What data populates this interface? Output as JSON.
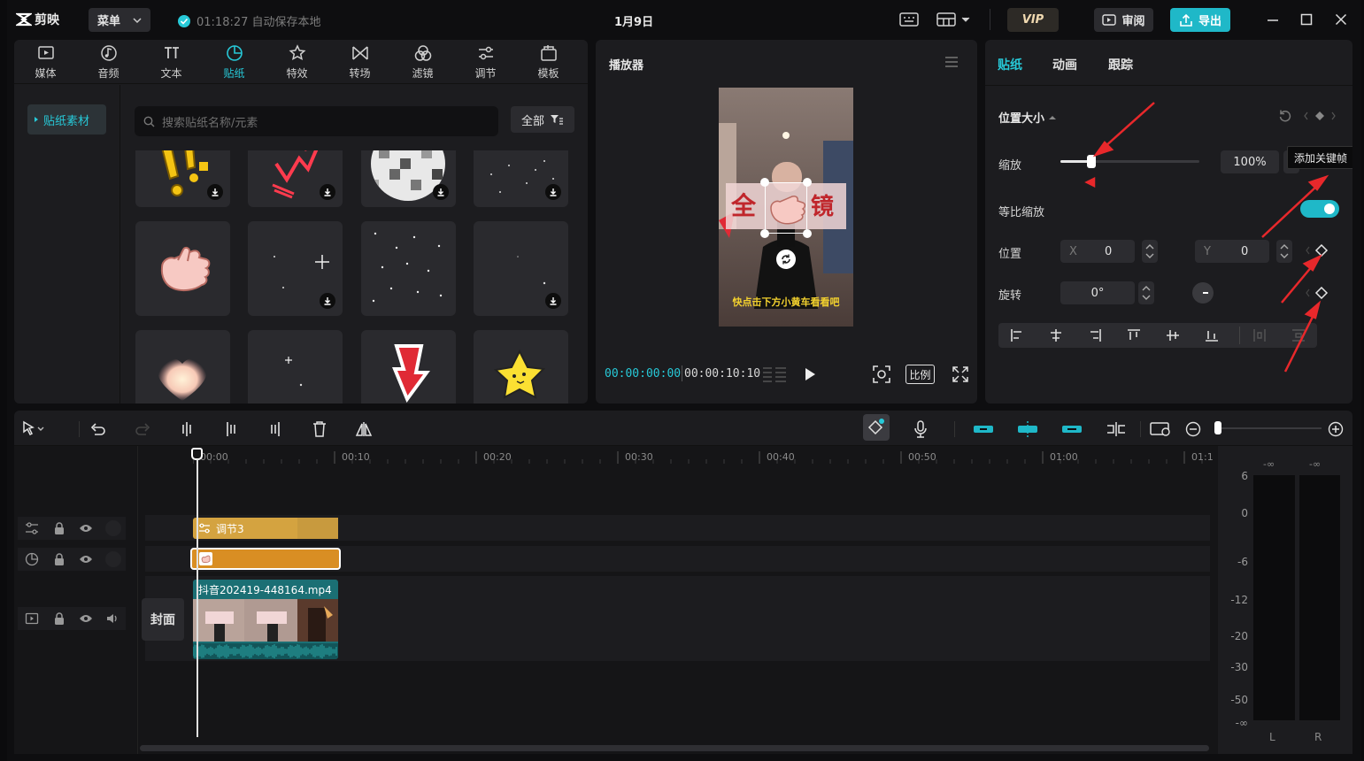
{
  "titlebar": {
    "app_name": "剪映",
    "menu_label": "菜单",
    "autosave": "01:18:27 自动保存本地",
    "project_title": "1月9日",
    "vip_label": "VIP",
    "review_label": "审阅",
    "export_label": "导出"
  },
  "media_tabs": [
    {
      "label": "媒体",
      "icon": "media-icon"
    },
    {
      "label": "音频",
      "icon": "audio-icon"
    },
    {
      "label": "文本",
      "icon": "text-icon"
    },
    {
      "label": "贴纸",
      "icon": "sticker-icon",
      "active": true
    },
    {
      "label": "特效",
      "icon": "effects-icon"
    },
    {
      "label": "转场",
      "icon": "transition-icon"
    },
    {
      "label": "滤镜",
      "icon": "filter-icon"
    },
    {
      "label": "调节",
      "icon": "adjust-icon"
    },
    {
      "label": "模板",
      "icon": "template-icon"
    }
  ],
  "sticker_panel": {
    "sidebar_item": "贴纸素材",
    "search_placeholder": "搜索贴纸名称/元素",
    "filter_label": "全部"
  },
  "player": {
    "title": "播放器",
    "current_time": "00:00:00:00",
    "total_time": "00:00:10:10",
    "ratio_label": "比例",
    "caption": "快点击下方小黄车看看吧",
    "overlay_text_left": "全",
    "overlay_text_right": "镜"
  },
  "inspector": {
    "tabs": [
      "贴纸",
      "动画",
      "跟踪"
    ],
    "section_title": "位置大小",
    "scale_label": "缩放",
    "scale_value": "100%",
    "scale_fraction": 0.22,
    "tooltip": "添加关键帧",
    "uniform_scale_label": "等比缩放",
    "position_label": "位置",
    "x_label": "X",
    "x_value": "0",
    "y_label": "Y",
    "y_value": "0",
    "rotation_label": "旋转",
    "rotation_value": "0°"
  },
  "timeline": {
    "ruler": [
      "00:00",
      "00:10",
      "00:20",
      "00:30",
      "00:40",
      "00:50",
      "01:00",
      "01:1"
    ],
    "adjust_clip": "调节3",
    "video_clip": "抖音202419-448164.mp4",
    "cover_label": "封面"
  },
  "meter": {
    "top_left": "-∞",
    "top_right": "-∞",
    "scale": [
      "6",
      "0",
      "-6",
      "-12",
      "-20",
      "-30",
      "-50",
      "-∞"
    ],
    "left_label": "L",
    "right_label": "R"
  },
  "colors": {
    "accent": "#27c9d8",
    "clip_gold": "#d4a340",
    "clip_teal": "#1b6f74",
    "annotation_red": "#e8282b"
  }
}
